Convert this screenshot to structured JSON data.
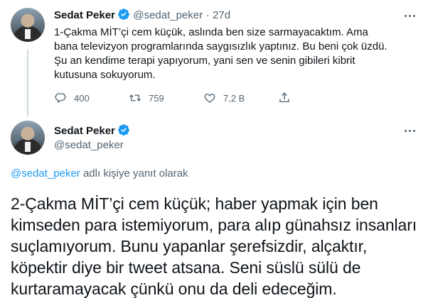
{
  "tweet1": {
    "author_name": "Sedat Peker",
    "handle": "@sedat_peker",
    "separator": "·",
    "age": "27d",
    "text": "1-Çakma MİT’çi cem küçük, aslında ben size sarmayacaktım. Ama bana televizyon programlarında saygısızlık yaptınız. Bu beni çok üzdü. Şu an kendime terapi yapıyorum, yani sen ve senin gibileri kibrit kutusuna sokuyorum.",
    "replies": "400",
    "retweets": "759",
    "likes": "7,2 B"
  },
  "tweet2": {
    "author_name": "Sedat Peker",
    "handle": "@sedat_peker",
    "reply_to_handle": "@sedat_peker",
    "reply_to_suffix": " adlı kişiye yanıt olarak",
    "text": "2-Çakma MİT’çi cem küçük; haber yapmak için ben kimseden para istemiyorum, para alıp günahsız insanları suçlamıyorum. Bunu yapanlar şerefsizdir, alçaktır, köpektir diye bir tweet atsana. Seni süslü sülü de kurtaramayacak çünkü onu da deli edeceğim."
  },
  "colors": {
    "accent": "#1d9bf0",
    "secondary_text": "#536471",
    "primary_text": "#0f1419"
  },
  "icons": [
    "verified-badge-icon",
    "more-options-icon",
    "reply-icon",
    "retweet-icon",
    "like-icon",
    "share-icon"
  ]
}
